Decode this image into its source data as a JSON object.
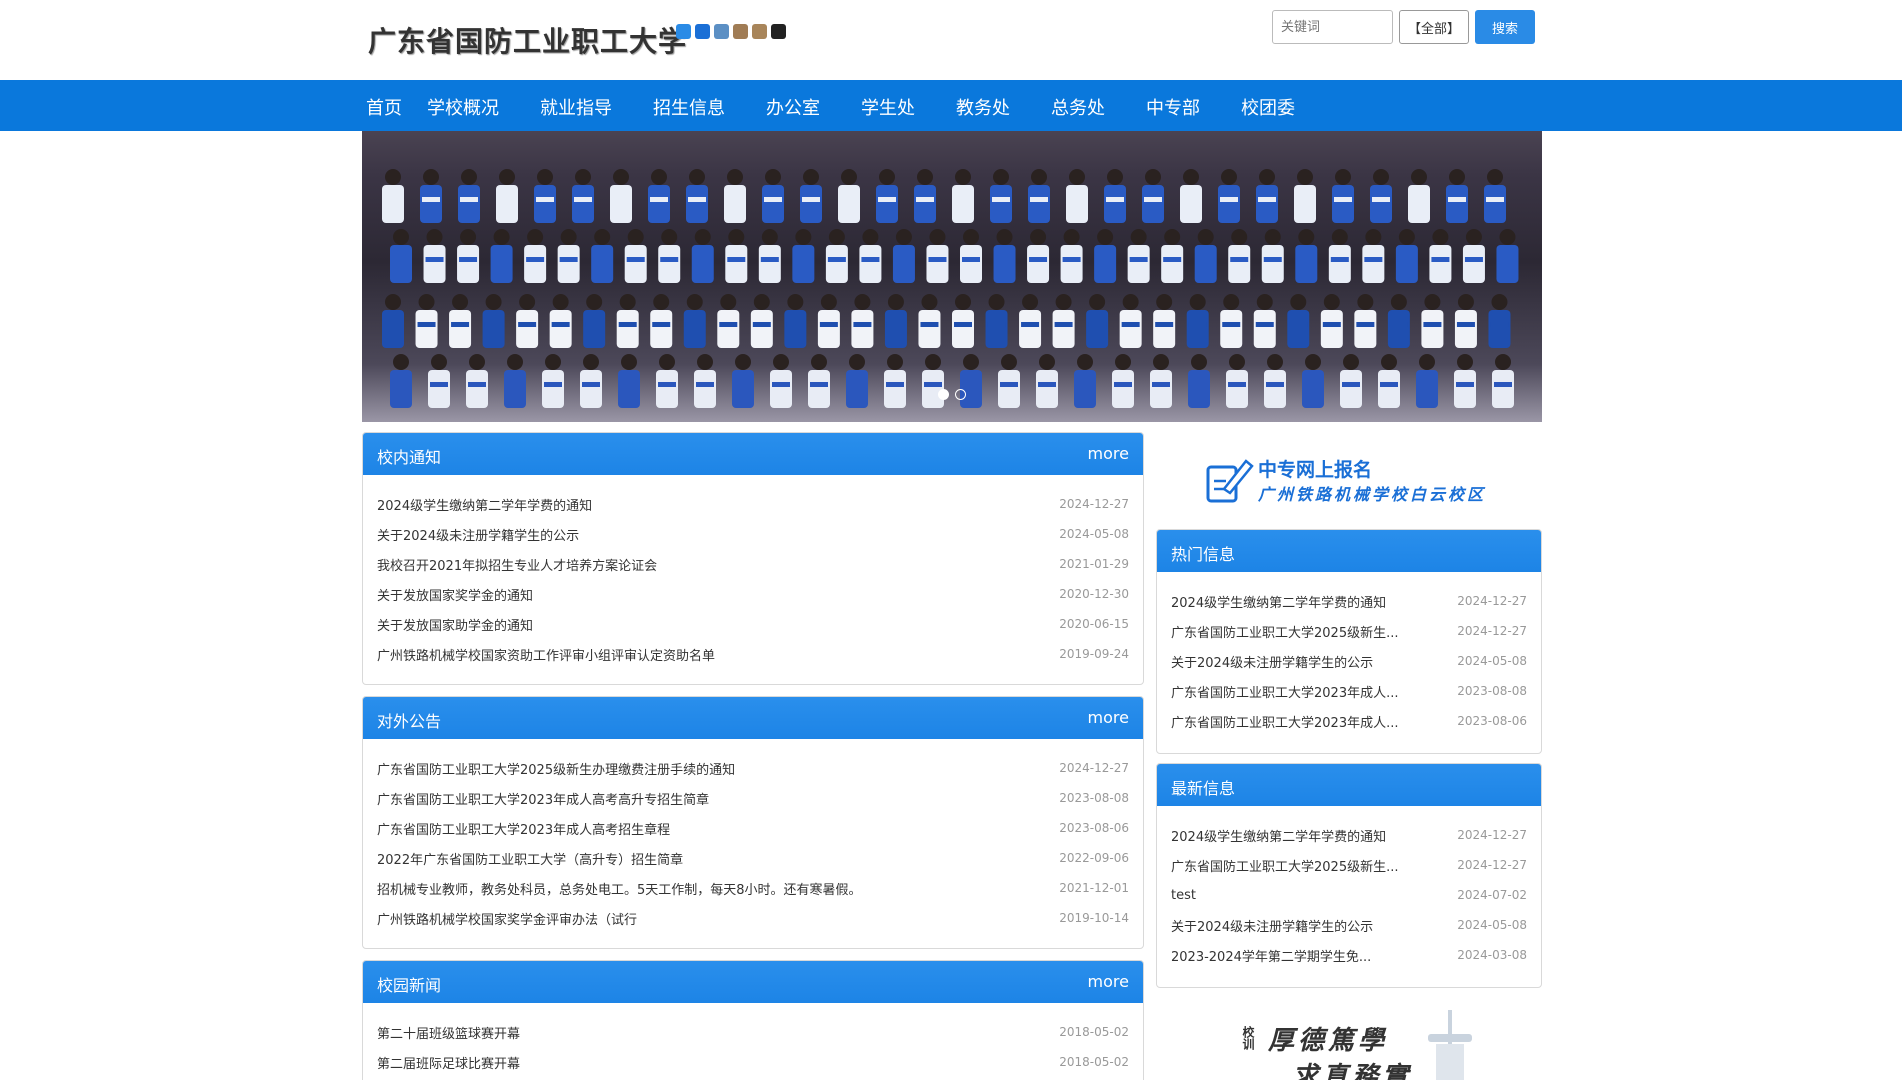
{
  "header": {
    "site_title": "广东省国防工业职工大学",
    "theme_swatches": [
      "#2a8be6",
      "#1a6fd6",
      "#5b8fc4",
      "#a07c55",
      "#a8855a",
      "#222222"
    ]
  },
  "search": {
    "placeholder": "关键词",
    "scope_label": "【全部】",
    "button_label": "搜索"
  },
  "nav": {
    "items": [
      "首页",
      "学校概况",
      "就业指导",
      "招生信息",
      "办公室",
      "学生处",
      "教务处",
      "总务处",
      "中专部",
      "校团委"
    ]
  },
  "banner": {
    "slides": 2,
    "active": 1
  },
  "panels": {
    "notice": {
      "title": "校内通知",
      "more": "more",
      "items": [
        {
          "title": "2024级学生缴纳第二学年学费的通知",
          "date": "2024-12-27"
        },
        {
          "title": "关于2024级未注册学籍学生的公示",
          "date": "2024-05-08"
        },
        {
          "title": "我校召开2021年拟招生专业人才培养方案论证会",
          "date": "2021-01-29"
        },
        {
          "title": "关于发放国家奖学金的通知",
          "date": "2020-12-30"
        },
        {
          "title": "关于发放国家助学金的通知",
          "date": "2020-06-15"
        },
        {
          "title": "广州铁路机械学校国家资助工作评审小组评审认定资助名单",
          "date": "2019-09-24"
        }
      ]
    },
    "announce": {
      "title": "对外公告",
      "more": "more",
      "items": [
        {
          "title": "广东省国防工业职工大学2025级新生办理缴费注册手续的通知",
          "date": "2024-12-27"
        },
        {
          "title": "广东省国防工业职工大学2023年成人高考高升专招生简章",
          "date": "2023-08-08"
        },
        {
          "title": "广东省国防工业职工大学2023年成人高考招生章程",
          "date": "2023-08-06"
        },
        {
          "title": "2022年广东省国防工业职工大学（高升专）招生简章",
          "date": "2022-09-06"
        },
        {
          "title": "招机械专业教师，教务处科员，总务处电工。5天工作制，每天8小时。还有寒暑假。",
          "date": "2021-12-01"
        },
        {
          "title": "广州铁路机械学校国家奖学金评审办法（试行",
          "date": "2019-10-14"
        }
      ]
    },
    "news": {
      "title": "校园新闻",
      "more": "more",
      "items": [
        {
          "title": "第二十届班级篮球赛开幕",
          "date": "2018-05-02"
        },
        {
          "title": "第二届班际足球比赛开幕",
          "date": "2018-05-02"
        }
      ]
    },
    "hot": {
      "title": "热门信息",
      "items": [
        {
          "title": "2024级学生缴纳第二学年学费的通知",
          "date": "2024-12-27"
        },
        {
          "title": "广东省国防工业职工大学2025级新生...",
          "date": "2024-12-27"
        },
        {
          "title": "关于2024级未注册学籍学生的公示",
          "date": "2024-05-08"
        },
        {
          "title": "广东省国防工业职工大学2023年成人...",
          "date": "2023-08-08"
        },
        {
          "title": "广东省国防工业职工大学2023年成人...",
          "date": "2023-08-06"
        }
      ]
    },
    "latest": {
      "title": "最新信息",
      "items": [
        {
          "title": "2024级学生缴纳第二学年学费的通知",
          "date": "2024-12-27"
        },
        {
          "title": "广东省国防工业职工大学2025级新生...",
          "date": "2024-12-27"
        },
        {
          "title": "test",
          "date": "2024-07-02"
        },
        {
          "title": "关于2024级未注册学籍学生的公示",
          "date": "2024-05-08"
        },
        {
          "title": "2023-2024学年第二学期学生免...",
          "date": "2024-03-08"
        }
      ]
    }
  },
  "promo": {
    "line1": "中专网上报名",
    "line2": "广州铁路机械学校白云校区"
  },
  "motto": {
    "label": "校训",
    "line1": "厚德篤學",
    "line2": "求真務實"
  }
}
